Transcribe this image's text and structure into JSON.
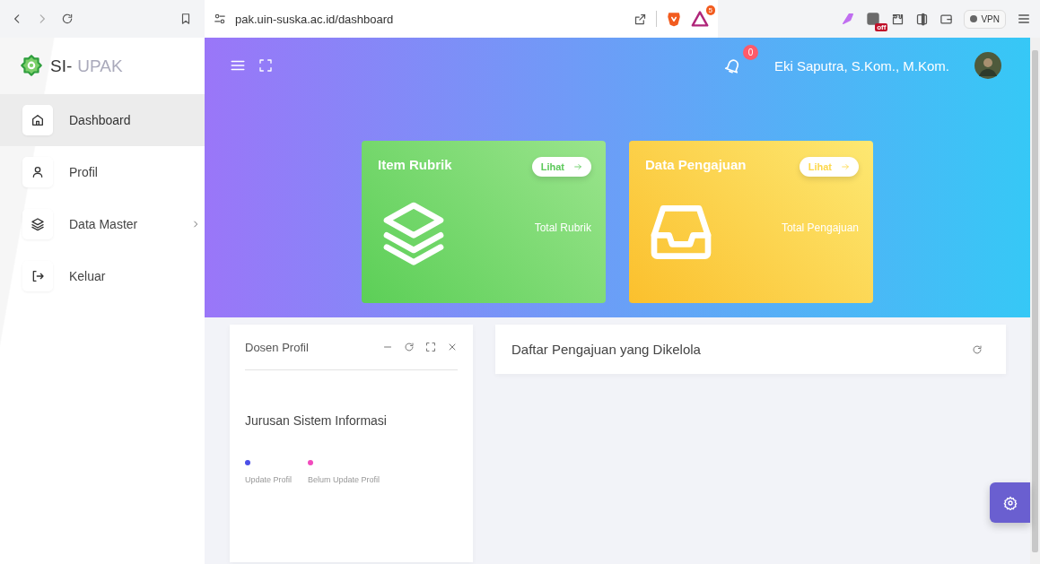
{
  "browser": {
    "address": "pak.uin-suska.ac.id/dashboard",
    "extension_badge": "5",
    "extension_label": "off",
    "vpn": "VPN"
  },
  "sidebar": {
    "brand_prefix": "SI-",
    "brand_name": "UPAK",
    "items": [
      {
        "label": "Dashboard",
        "kind": "home",
        "selected": true,
        "has_submenu": false
      },
      {
        "label": "Profil",
        "kind": "user",
        "selected": false,
        "has_submenu": false
      },
      {
        "label": "Data Master",
        "kind": "layers",
        "selected": false,
        "has_submenu": true
      },
      {
        "label": "Keluar",
        "kind": "logout",
        "selected": false,
        "has_submenu": false
      }
    ]
  },
  "topbar": {
    "notification_count": "0",
    "user_name": "Eki Saputra, S.Kom., M.Kom."
  },
  "cards": [
    {
      "title": "Item Rubrik",
      "button": "Lihat",
      "caption": "Total Rubrik",
      "kind": "layers"
    },
    {
      "title": "Data Pengajuan",
      "button": "Lihat",
      "caption": "Total Pengajuan",
      "kind": "inbox"
    }
  ],
  "profile_panel": {
    "title": "Dosen Profil",
    "department": "Jurusan Sistem Informasi",
    "legend": [
      {
        "label": "Update Profil",
        "color": "#4b4fe8"
      },
      {
        "label": "Belum Update Profil",
        "color": "#f24bbd"
      }
    ]
  },
  "list_panel": {
    "title": "Daftar Pengajuan yang Dikelola"
  }
}
